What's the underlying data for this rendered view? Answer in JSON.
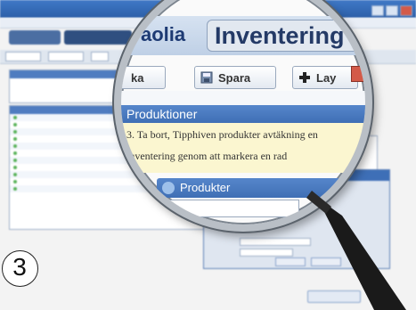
{
  "lens": {
    "title": "Inventering",
    "left_title": "aolia",
    "buttons": [
      {
        "label": "Spara"
      },
      {
        "label": "Lay"
      }
    ],
    "partial_button": "ka",
    "section_title": "Produktioner",
    "note_lines": [
      "3. Ta bort, Tipphiven produkter avtäkning en",
      "inventering genom att markera en rad"
    ],
    "sub_title": "Produkter"
  },
  "badge": {
    "number": "3"
  },
  "colors": {
    "accent": "#3e6fb7",
    "handle": "#111111"
  }
}
